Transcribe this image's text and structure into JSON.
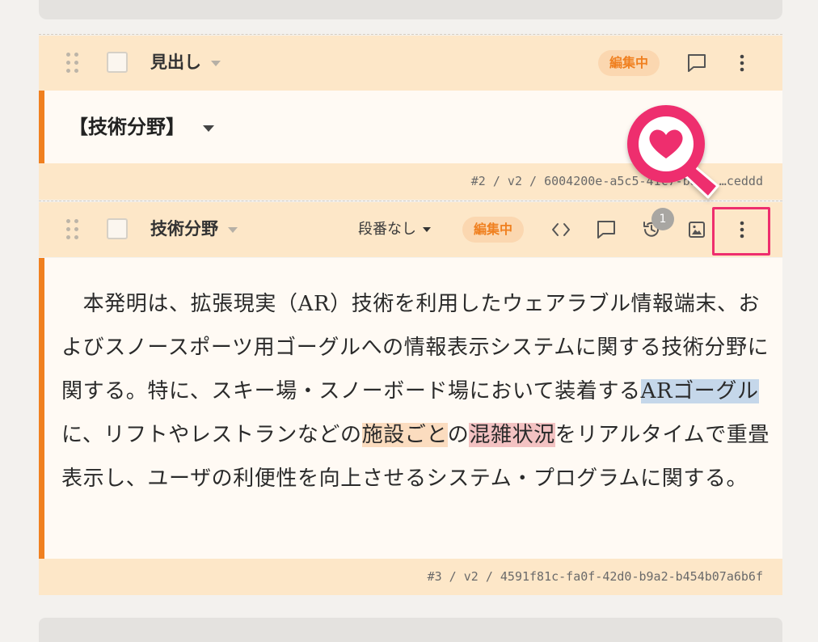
{
  "blocks": [
    {
      "type_label": "見出し",
      "status_badge": "編集中",
      "content": "【技術分野】",
      "footer_id": "#2 / v2 / 6004200e-a5c5-41c7-ba4… …ceddd"
    },
    {
      "type_label": "技術分野",
      "paragraph_select": "段番なし",
      "status_badge": "編集中",
      "history_count": "1",
      "text": {
        "s1": "　本発明は、拡張現実（AR）技術を利用したウェアラブル情報端末、およびスノースポーツ用ゴーグルへの情報表示システムに関する技術分野に関する。特に、スキー場・スノーボード場において装着する",
        "hl1": "ARゴーグル",
        "s2": "に、リフトやレストランなどの",
        "hl2": "施設ごと",
        "s3": "の",
        "hl3": "混雑状況",
        "s4": "をリアルタイムで重畳表示し、ユーザの利便性を向上させるシステム・プログラムに関する。"
      },
      "footer_id": "#3 / v2 / 4591f81c-fa0f-42d0-b9a2-b454b07a6b6f"
    }
  ],
  "icons": {
    "drag": "drag-handle-icon",
    "comment": "comment-icon",
    "more": "more-vertical-icon",
    "code": "code-icon",
    "history": "history-icon",
    "image": "image-icon",
    "heart": "heart-icon"
  },
  "colors": {
    "accent_orange": "#f08020",
    "header_bg": "#fde7c8",
    "highlight_pink": "#ee2e6e",
    "highlight_blue": "#c5d7ea",
    "highlight_peach": "#fbdcbf",
    "highlight_red": "#f3c2c2"
  }
}
